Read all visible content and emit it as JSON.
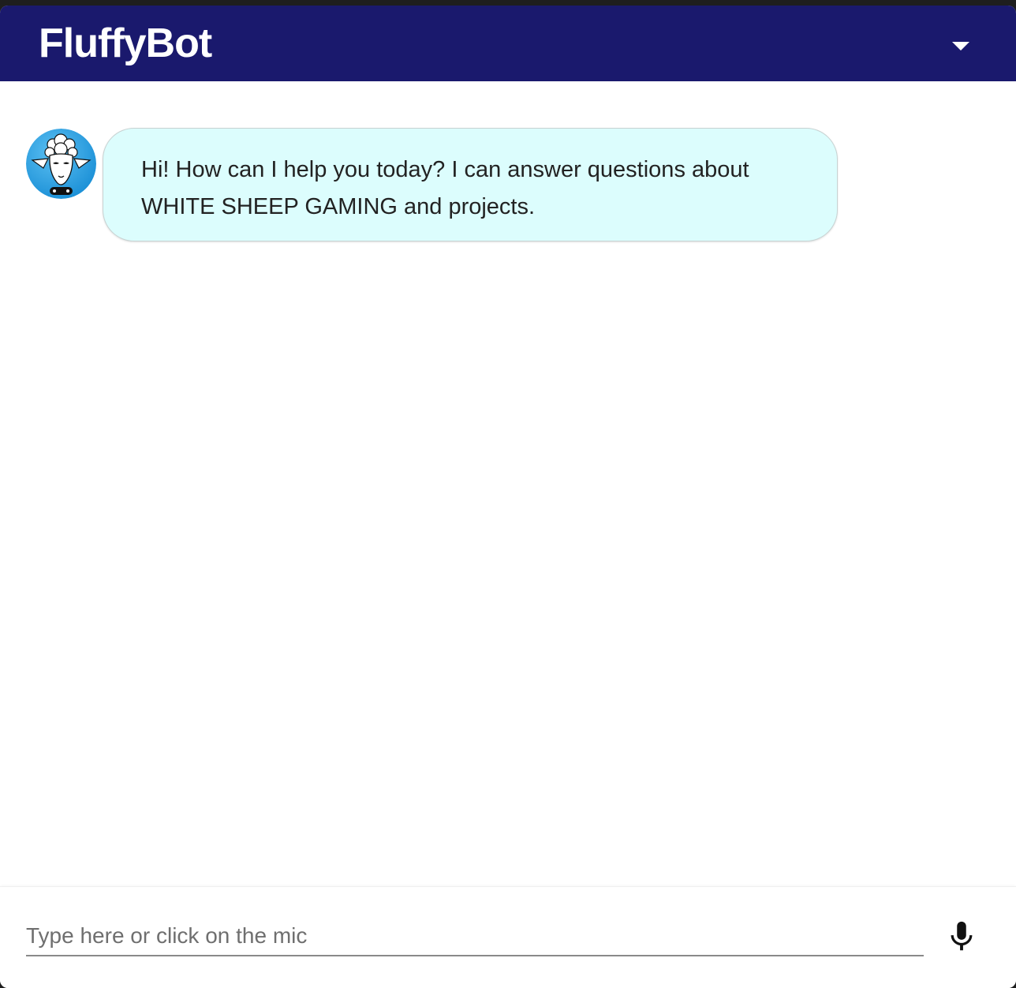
{
  "header": {
    "title": "FluffyBot",
    "menu_icon": "caret-down-icon",
    "background_color": "#1a196d"
  },
  "messages": [
    {
      "sender": "bot",
      "avatar_icon": "sheep-avatar-icon",
      "text": "Hi! How can I help you today? I can answer questions about WHITE SHEEP GAMING and projects."
    }
  ],
  "composer": {
    "value": "",
    "placeholder": "Type here or click on the mic",
    "mic_icon": "microphone-icon"
  },
  "colors": {
    "bubble_background": "#dcfdfd",
    "avatar_background": "#2aa2e6"
  }
}
